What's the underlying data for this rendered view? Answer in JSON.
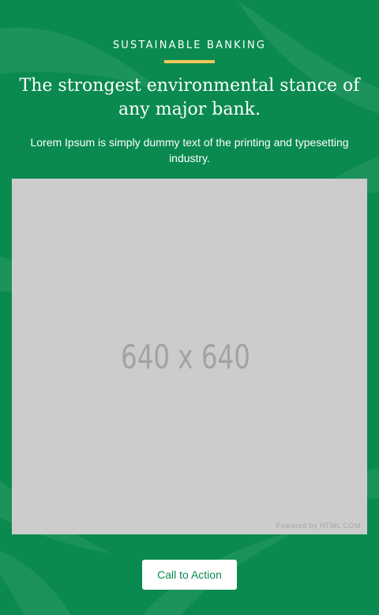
{
  "hero": {
    "eyebrow": "SUSTAINABLE BANKING",
    "headline": "The strongest environmental stance of any major bank.",
    "subtext": "Lorem Ipsum is simply dummy text of the printing and typesetting industry.",
    "image_placeholder_text": "640 x 640",
    "image_credit": "Powered by HTML.COM",
    "cta_label": "Call to Action"
  },
  "colors": {
    "background": "#0a8a4f",
    "accent_underline": "#f1c75b",
    "button_bg": "#ffffff",
    "button_text": "#0a8a4f",
    "placeholder_bg": "#cccccc",
    "placeholder_text": "#a3a3a3"
  }
}
